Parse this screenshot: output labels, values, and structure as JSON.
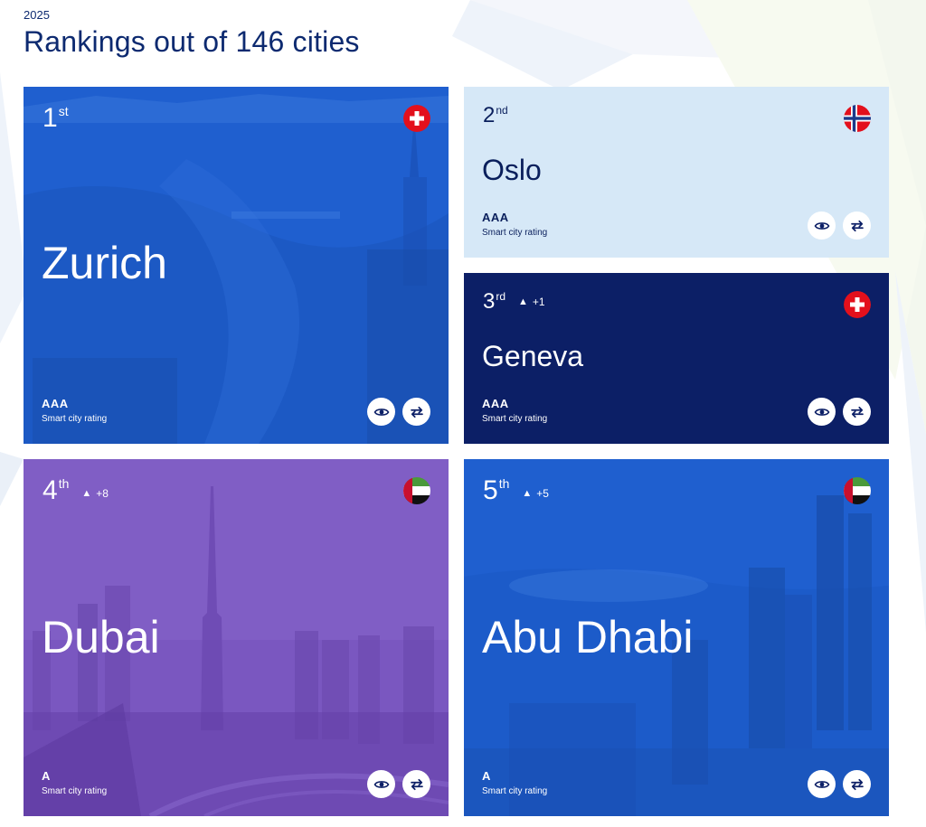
{
  "header": {
    "year": "2025",
    "title": "Rankings out of 146 cities"
  },
  "colors": {
    "title": "#0d2a70",
    "card_blue": "#1f5fcf",
    "card_light": "#d6e8f7",
    "card_navy": "#0c1f66",
    "card_purple": "#7a57c0"
  },
  "cards": [
    {
      "rank": "1",
      "suffix": "st",
      "change": "",
      "city": "Zurich",
      "rating": "AAA",
      "rating_label": "Smart city rating",
      "flag": "switzerland-flag-icon"
    },
    {
      "rank": "2",
      "suffix": "nd",
      "change": "",
      "city": "Oslo",
      "rating": "AAA",
      "rating_label": "Smart city rating",
      "flag": "norway-flag-icon"
    },
    {
      "rank": "3",
      "suffix": "rd",
      "change": "+1",
      "city": "Geneva",
      "rating": "AAA",
      "rating_label": "Smart city rating",
      "flag": "switzerland-flag-icon"
    },
    {
      "rank": "4",
      "suffix": "th",
      "change": "+8",
      "city": "Dubai",
      "rating": "A",
      "rating_label": "Smart city rating",
      "flag": "uae-flag-icon"
    },
    {
      "rank": "5",
      "suffix": "th",
      "change": "+5",
      "city": "Abu Dhabi",
      "rating": "A",
      "rating_label": "Smart city rating",
      "flag": "uae-flag-icon"
    }
  ],
  "icons": {
    "view": "eye-icon",
    "compare": "compare-arrows-icon",
    "change": "triangle-up-icon"
  }
}
